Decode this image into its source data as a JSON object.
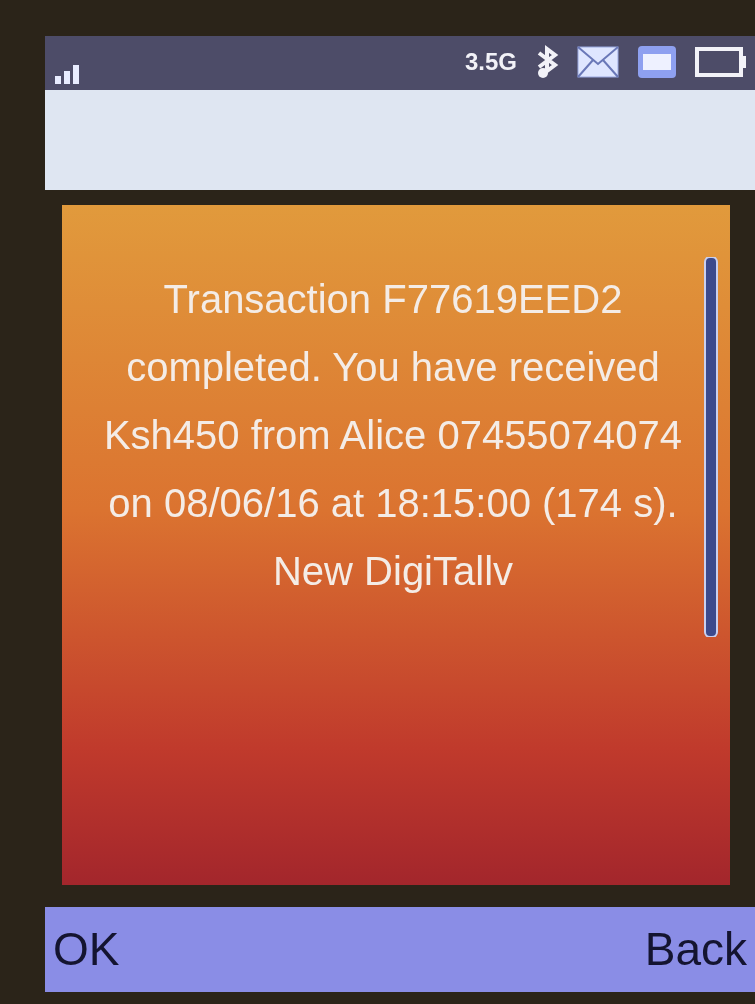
{
  "status_bar": {
    "network": "3.5G"
  },
  "message": {
    "text": "Transaction F77619EED2 completed. You have received Ksh450 from Alice 07455074074 on 08/06/16 at 18:15:00 (174 s). New DigiTallv"
  },
  "softkeys": {
    "left": "OK",
    "right": "Back"
  }
}
